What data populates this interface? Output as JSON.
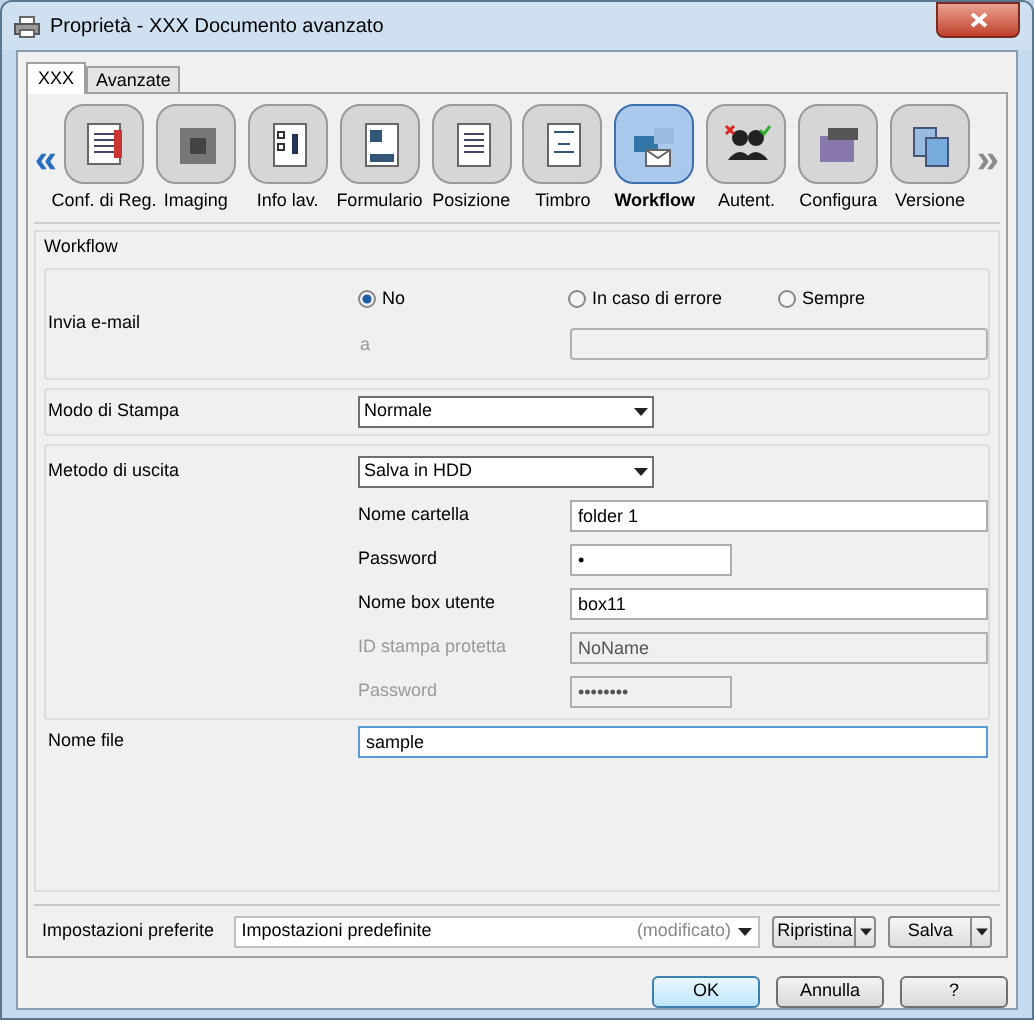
{
  "window": {
    "title": "Proprietà - XXX Documento avanzato"
  },
  "tabs": [
    {
      "label": "XXX",
      "selected": true
    },
    {
      "label": "Avanzate",
      "selected": false
    }
  ],
  "toolbar": {
    "scroll_left": {
      "glyph": "«",
      "disabled": false
    },
    "scroll_right": {
      "glyph": "»",
      "disabled": true
    },
    "items": [
      {
        "label": "Conf. di Reg.",
        "selected": false
      },
      {
        "label": "Imaging",
        "selected": false
      },
      {
        "label": "Info lav.",
        "selected": false
      },
      {
        "label": "Formulario",
        "selected": false
      },
      {
        "label": "Posizione",
        "selected": false
      },
      {
        "label": "Timbro",
        "selected": false
      },
      {
        "label": "Workflow",
        "selected": true
      },
      {
        "label": "Autent.",
        "selected": false
      },
      {
        "label": "Configura",
        "selected": false
      },
      {
        "label": "Versione",
        "selected": false
      }
    ]
  },
  "group": {
    "title": "Workflow",
    "email": {
      "label": "Invia e-mail",
      "options": [
        {
          "label": "No",
          "selected": true
        },
        {
          "label": "In caso di errore",
          "selected": false
        },
        {
          "label": "Sempre",
          "selected": false
        }
      ],
      "recipient": {
        "label": "a",
        "disabled": true
      }
    },
    "print_mode": {
      "label": "Modo di Stampa",
      "value": "Normale"
    },
    "output": {
      "label": "Metodo di uscita",
      "value": "Salva in HDD",
      "fields": [
        {
          "label": "Nome cartella",
          "value": "folder 1",
          "kind": "text",
          "disabled": false
        },
        {
          "label": "Password",
          "value": "•",
          "kind": "password",
          "disabled": false
        },
        {
          "label": "Nome box utente",
          "value": "box11",
          "kind": "text",
          "disabled": false
        },
        {
          "label": "ID stampa protetta",
          "value": "NoName",
          "kind": "text",
          "disabled": true
        },
        {
          "label": "Password",
          "value": "••••••••",
          "kind": "password",
          "disabled": true
        }
      ]
    },
    "file_name": {
      "label": "Nome file",
      "value": "sample",
      "focused": true
    }
  },
  "footer": {
    "label": "Impostazioni preferite",
    "value": "Impostazioni predefinite",
    "note": "(modificato)",
    "split_buttons": [
      "Ripristina",
      "Salva"
    ]
  },
  "buttons": [
    {
      "label": "OK",
      "default": true
    },
    {
      "label": "Annulla",
      "default": false
    },
    {
      "label": "?",
      "default": false
    }
  ]
}
